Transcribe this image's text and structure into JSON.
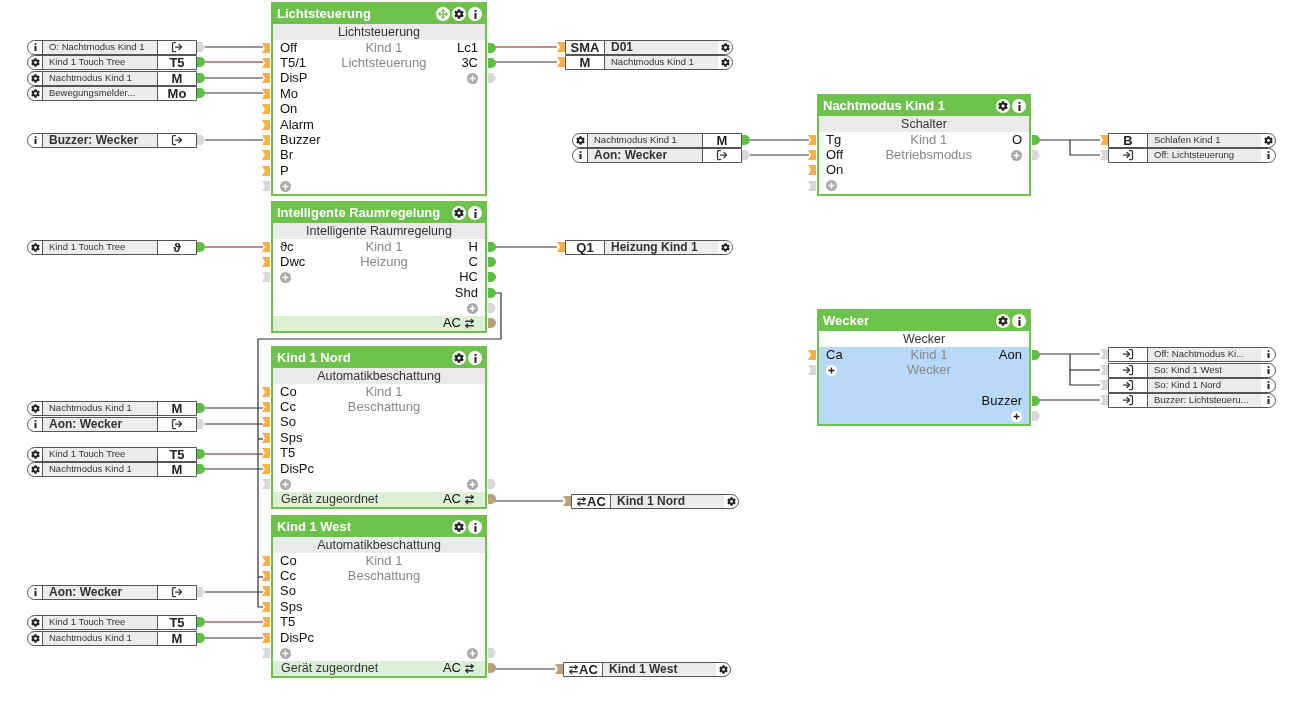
{
  "blocks": [
    {
      "title": "Lichtsteuerung",
      "subtitle": "Lichtsteuerung",
      "room": "Kind 1",
      "category": "Lichtsteuerung",
      "move_handle": true,
      "selected": false,
      "inputs": [
        "Off",
        "T5/1",
        "DisP",
        "Mo",
        "On",
        "Alarm",
        "Buzzer",
        "Br",
        "P"
      ],
      "outputs": [
        "Lc1",
        "3C"
      ]
    },
    {
      "title": "Intelligente Raumregelung",
      "subtitle": "Intelligente Raumregelung",
      "room": "Kind 1",
      "category": "Heizung",
      "move_handle": false,
      "selected": false,
      "inputs": [
        "ϑc",
        "Dwc"
      ],
      "outputs": [
        "H",
        "C",
        "HC",
        "Shd"
      ],
      "footer": {
        "right": "AC"
      }
    },
    {
      "title": "Kind 1 Nord",
      "subtitle": "Automatikbeschattung",
      "room": "Kind 1",
      "category": "Beschattung",
      "move_handle": false,
      "selected": false,
      "inputs": [
        "Co",
        "Cc",
        "So",
        "Sps",
        "T5",
        "DisPc"
      ],
      "footer": {
        "left": "Gerät zugeordnet",
        "right": "AC"
      }
    },
    {
      "title": "Kind 1 West",
      "subtitle": "Automatikbeschattung",
      "room": "Kind 1",
      "category": "Beschattung",
      "move_handle": false,
      "selected": false,
      "inputs": [
        "Co",
        "Cc",
        "So",
        "Sps",
        "T5",
        "DisPc"
      ],
      "footer": {
        "left": "Gerät zugeordnet",
        "right": "AC"
      }
    },
    {
      "title": "Nachtmodus Kind 1",
      "subtitle": "Schalter",
      "room": "Kind 1",
      "category": "Betriebsmodus",
      "move_handle": false,
      "selected": false,
      "inputs": [
        "Tg",
        "Off",
        "On"
      ],
      "outputs": [
        "O"
      ]
    },
    {
      "title": "Wecker",
      "subtitle": "Wecker",
      "room": "Kind 1",
      "category": "Wecker",
      "move_handle": false,
      "selected": true,
      "inputs": [
        "Ca"
      ],
      "outputs": [
        "Aon",
        "Buzzer"
      ]
    }
  ],
  "input_refs": [
    {
      "text": "O: Nachtmodus Kind 1",
      "kind": "exit",
      "bold": false
    },
    {
      "text": "Kind 1 Touch Tree",
      "kind": "text",
      "code": "T5",
      "bold": false
    },
    {
      "text": "Nachtmodus Kind 1",
      "kind": "text",
      "code": "M",
      "bold": false
    },
    {
      "text": "Bewegungsmelder...",
      "kind": "text",
      "code": "Mo",
      "bold": false
    },
    {
      "text": "Buzzer: Wecker",
      "kind": "exit",
      "bold": true
    },
    {
      "text": "Nachtmodus Kind 1",
      "kind": "text",
      "code": "M",
      "bold": false
    },
    {
      "text": "Aon: Wecker",
      "kind": "exit",
      "bold": true
    },
    {
      "text": "Kind 1 Touch Tree",
      "kind": "text",
      "code": "ϑ",
      "bold": false
    },
    {
      "text": "Nachtmodus Kind 1",
      "kind": "text",
      "code": "M",
      "bold": false
    },
    {
      "text": "Aon: Wecker",
      "kind": "exit",
      "bold": true
    },
    {
      "text": "Kind 1 Touch Tree",
      "kind": "text",
      "code": "T5",
      "bold": false
    },
    {
      "text": "Nachtmodus Kind 1",
      "kind": "text",
      "code": "M",
      "bold": false
    },
    {
      "text": "Aon: Wecker",
      "kind": "exit",
      "bold": true
    },
    {
      "text": "Kind 1 Touch Tree",
      "kind": "text",
      "code": "T5",
      "bold": false
    },
    {
      "text": "Nachtmodus Kind 1",
      "kind": "text",
      "code": "M",
      "bold": false
    }
  ],
  "output_refs": [
    {
      "text": "D01",
      "kind": "text",
      "code": "SMA",
      "bold": true
    },
    {
      "text": "Nachtmodus Kind 1",
      "kind": "text",
      "code": "M",
      "bold": false
    },
    {
      "text": "Schlafen Kind 1",
      "kind": "text",
      "code": "B",
      "bold": false
    },
    {
      "text": "Off: Lichtsteuerung",
      "kind": "entry",
      "bold": false
    },
    {
      "text": "Heizung Kind 1",
      "kind": "text",
      "code": "Q1",
      "bold": true
    },
    {
      "text": "Off: Nachtmodus Ki...",
      "kind": "entry",
      "bold": false
    },
    {
      "text": "So: Kind 1 West",
      "kind": "entry",
      "bold": false
    },
    {
      "text": "So: Kind 1 Nord",
      "kind": "entry",
      "bold": false
    },
    {
      "text": "Buzzer: Lichtsteueru...",
      "kind": "entry",
      "bold": false
    },
    {
      "text": "Kind 1 Nord",
      "kind": "ac",
      "code": "AC",
      "bold": true
    },
    {
      "text": "Kind 1 West",
      "kind": "ac",
      "code": "AC",
      "bold": true
    }
  ]
}
